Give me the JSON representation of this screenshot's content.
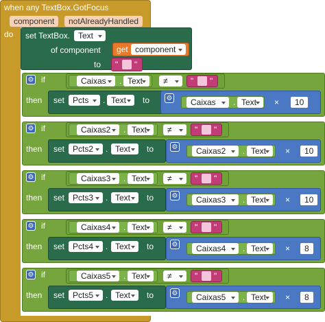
{
  "event": {
    "title": "when any TextBox.GotFocus",
    "param1": "component",
    "param2": "notAlreadyHandled",
    "do_label": "do"
  },
  "first_set": {
    "set_label": "set TextBox.",
    "property": "Text",
    "of_component_label": "of component",
    "get_label": "get",
    "get_var": "component",
    "to_label": "to",
    "text_quote_open": "\"",
    "text_quote_close": "\""
  },
  "blocks": [
    {
      "if_label": "if",
      "then_label": "then",
      "compare_comp": "Caixas",
      "compare_prop": "Text",
      "operator": "≠",
      "set_label": "set",
      "target_comp": "Pcts",
      "target_prop": "Text",
      "to_label": "to",
      "math_comp": "Caixas",
      "math_prop": "Text",
      "times": "×",
      "number": "10"
    },
    {
      "if_label": "if",
      "then_label": "then",
      "compare_comp": "Caixas2",
      "compare_prop": "Text",
      "operator": "≠",
      "set_label": "set",
      "target_comp": "Pcts2",
      "target_prop": "Text",
      "to_label": "to",
      "math_comp": "Caixas2",
      "math_prop": "Text",
      "times": "×",
      "number": "10"
    },
    {
      "if_label": "if",
      "then_label": "then",
      "compare_comp": "Caixas3",
      "compare_prop": "Text",
      "operator": "≠",
      "set_label": "set",
      "target_comp": "Pcts3",
      "target_prop": "Text",
      "to_label": "to",
      "math_comp": "Caixas3",
      "math_prop": "Text",
      "times": "×",
      "number": "10"
    },
    {
      "if_label": "if",
      "then_label": "then",
      "compare_comp": "Caixas4",
      "compare_prop": "Text",
      "operator": "≠",
      "set_label": "set",
      "target_comp": "Pcts4",
      "target_prop": "Text",
      "to_label": "to",
      "math_comp": "Caixas4",
      "math_prop": "Text",
      "times": "×",
      "number": "8"
    },
    {
      "if_label": "if",
      "then_label": "then",
      "compare_comp": "Caixas5",
      "compare_prop": "Text",
      "operator": "≠",
      "set_label": "set",
      "target_comp": "Pcts5",
      "target_prop": "Text",
      "to_label": "to",
      "math_comp": "Caixas5",
      "math_prop": "Text",
      "times": "×",
      "number": "8"
    }
  ],
  "dot": ".",
  "quote": "\"",
  "gear_icon": "gear-icon",
  "colors": {
    "event": "#c89a2a",
    "set": "#2a6b4b",
    "if": "#75a53c",
    "math": "#4a78c2",
    "text": "#c23d78",
    "get": "#e8782a"
  }
}
